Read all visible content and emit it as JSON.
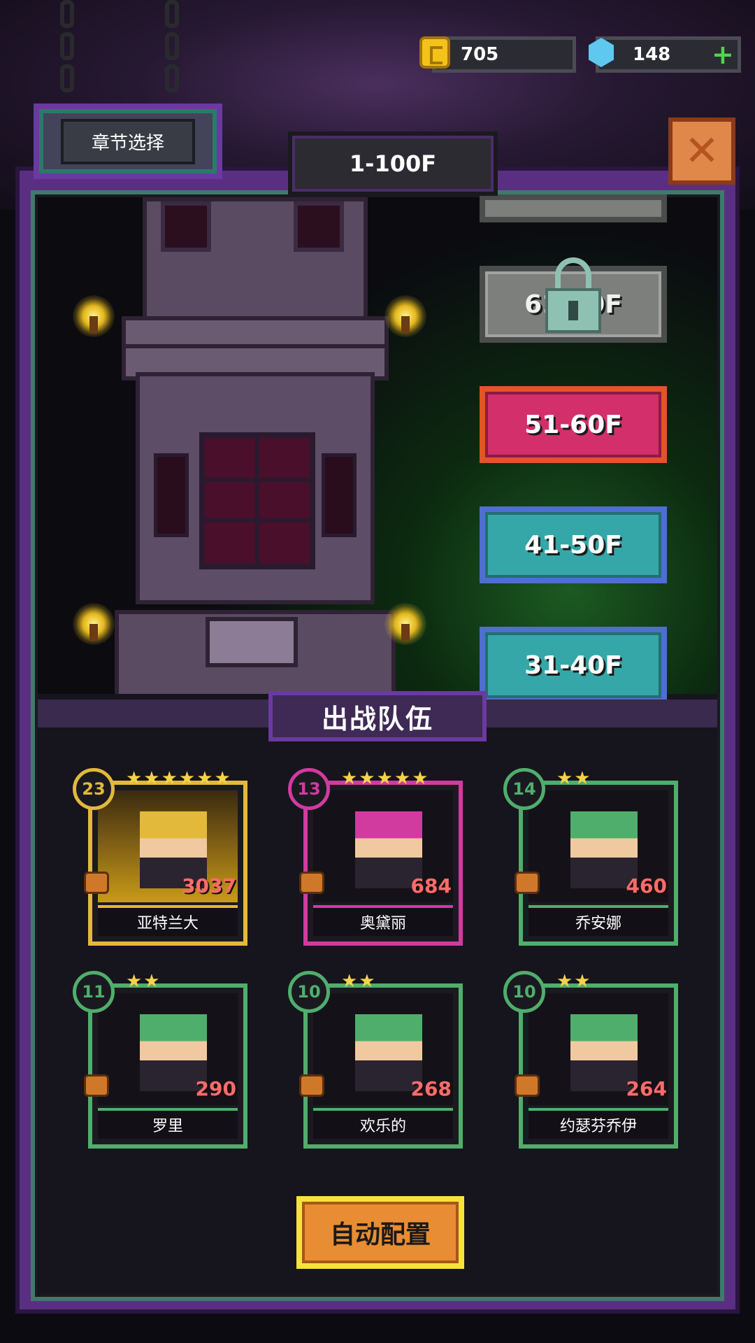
{
  "hud": {
    "coins": "705",
    "gems": "148",
    "coin_icon": "gold-coin-icon",
    "gem_icon": "blue-gem-icon",
    "plus_icon": "plus-icon"
  },
  "header": {
    "chapter_select_label": "章节选择",
    "range_title": "1-100F",
    "close_icon": "close-icon"
  },
  "floors": [
    {
      "label": "61-70F",
      "state": "locked"
    },
    {
      "label": "51-60F",
      "state": "current",
      "color": "#d32f6a"
    },
    {
      "label": "41-50F",
      "state": "cleared",
      "color": "#35a7a8"
    },
    {
      "label": "31-40F",
      "state": "cleared",
      "color": "#35a7a8"
    }
  ],
  "team": {
    "title": "出战队伍",
    "heroes": [
      {
        "name": "亚特兰大",
        "level": "23",
        "stars": "★★★★★★",
        "power": "3037",
        "color": "#e2b93a"
      },
      {
        "name": "奥黛丽",
        "level": "13",
        "stars": "★★★★★",
        "power": "684",
        "color": "#d13ba0"
      },
      {
        "name": "乔安娜",
        "level": "14",
        "stars": "★★",
        "power": "460",
        "color": "#4fae6c"
      },
      {
        "name": "罗里",
        "level": "11",
        "stars": "★★",
        "power": "290",
        "color": "#4fae6c"
      },
      {
        "name": "欢乐的",
        "level": "10",
        "stars": "★★",
        "power": "268",
        "color": "#4fae6c"
      },
      {
        "name": "约瑟芬乔伊",
        "level": "10",
        "stars": "★★",
        "power": "264",
        "color": "#4fae6c"
      }
    ]
  },
  "actions": {
    "auto_config_label": "自动配置"
  }
}
